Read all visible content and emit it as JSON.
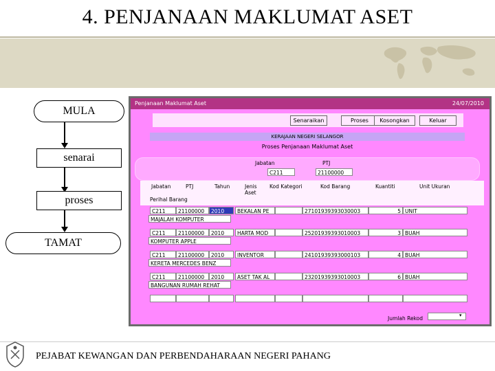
{
  "slide": {
    "title": "4. PENJANAAN MAKLUMAT ASET",
    "footer": "PEJABAT KEWANGAN DAN PERBENDAHARAAN NEGERI PAHANG"
  },
  "flowchart": {
    "nodes": [
      "MULA",
      "senarai",
      "proses",
      "TAMAT"
    ]
  },
  "app": {
    "window_title": "Penjanaan Maklumat Aset",
    "date": "24/07/2010",
    "buttons": [
      "Senaraikan",
      "Proses",
      "Kosongkan",
      "Keluar"
    ],
    "header_org": "KERAJAAN NEGERI SELANGOR",
    "header_title": "Proses Penjanaan Maklumat Aset",
    "filter": {
      "jabatan_label": "Jabatan",
      "ptj_label": "PTJ",
      "jabatan_value": "C211",
      "ptj_value": "21100000"
    },
    "columns": [
      "Jabatan",
      "PTJ",
      "Tahun",
      "Jenis Aset",
      "Kod Kategori",
      "Kod Barang",
      "Kuantiti",
      "Unit Ukuran"
    ],
    "perihal_label": "Perihal Barang",
    "rows": [
      {
        "jabatan": "C211",
        "ptj": "21100000",
        "tahun": "2010",
        "jenis": "BEKALAN PE",
        "kategori": "",
        "barang": "27101939393030003",
        "kuantiti": "5",
        "unit": "UNIT",
        "perihal": "MAJALAH KOMPUTER"
      },
      {
        "jabatan": "C211",
        "ptj": "21100000",
        "tahun": "2010",
        "jenis": "HARTA MOD",
        "kategori": "",
        "barang": "25201939393010003",
        "kuantiti": "3",
        "unit": "BUAH",
        "perihal": "KOMPUTER APPLE"
      },
      {
        "jabatan": "C211",
        "ptj": "21100000",
        "tahun": "2010",
        "jenis": "INVENTOR",
        "kategori": "",
        "barang": "24101939393000103",
        "kuantiti": "4",
        "unit": "BUAH",
        "perihal": "KERETA MERCEDES BENZ"
      },
      {
        "jabatan": "C211",
        "ptj": "21100000",
        "tahun": "2010",
        "jenis": "ASET TAK AL",
        "kategori": "",
        "barang": "23201939393010003",
        "kuantiti": "6",
        "unit": "BUAH",
        "perihal": "BANGUNAN RUMAH REHAT"
      }
    ],
    "jumlah_label": "Jumlah Rekod",
    "jumlah_value": ""
  },
  "colors": {
    "window_bg": "#ff88ff",
    "titlebar": "#b33385",
    "header_band": "#c6a5f5",
    "selection": "#2e3ab8",
    "slide_band": "#ddd9c4"
  },
  "icons": [
    "world-map-icon",
    "crest-logo-icon",
    "dropdown-arrow-icon"
  ]
}
